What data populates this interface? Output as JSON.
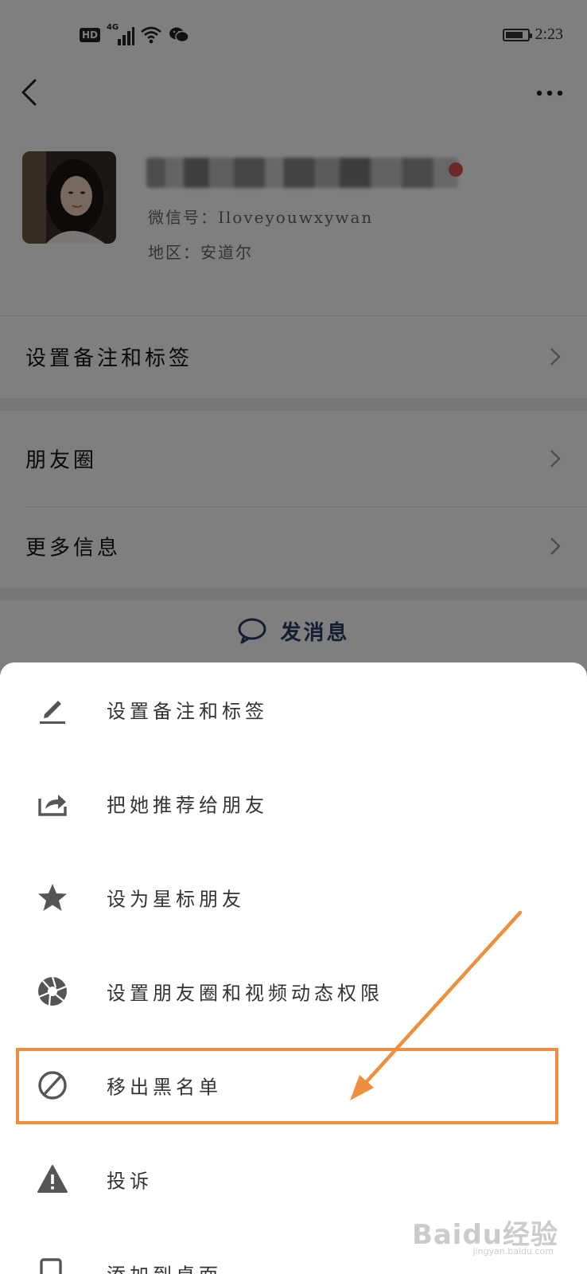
{
  "status_bar": {
    "hd": "HD",
    "network": "4G",
    "time": "2:23",
    "icons": [
      "signal-icon",
      "wifi-icon",
      "wechat-icon",
      "battery-icon"
    ]
  },
  "nav": {
    "back_icon": "back-arrow-icon",
    "more_icon": "more-icon"
  },
  "profile": {
    "wechat_id": "微信号：Iloveyouwxywan",
    "region": "地区：安道尔"
  },
  "list": {
    "remark_label": "设置备注和标签",
    "moments_label": "朋友圈",
    "more_info_label": "更多信息",
    "send_message_label": "发消息"
  },
  "sheet": {
    "items": [
      {
        "label": "设置备注和标签",
        "icon": "pencil-icon"
      },
      {
        "label": "把她推荐给朋友",
        "icon": "share-icon"
      },
      {
        "label": "设为星标朋友",
        "icon": "star-icon"
      },
      {
        "label": "设置朋友圈和视频动态权限",
        "icon": "aperture-icon"
      },
      {
        "label": "移出黑名单",
        "icon": "forbidden-icon"
      },
      {
        "label": "投诉",
        "icon": "warning-icon"
      },
      {
        "label": "添加到桌面",
        "icon": "add-to-desktop-icon"
      }
    ]
  },
  "annotation": {
    "highlight_color": "#ef8f3e"
  },
  "watermark": {
    "text": "Baidu经验",
    "sub": "jingyan.baidu.com"
  }
}
